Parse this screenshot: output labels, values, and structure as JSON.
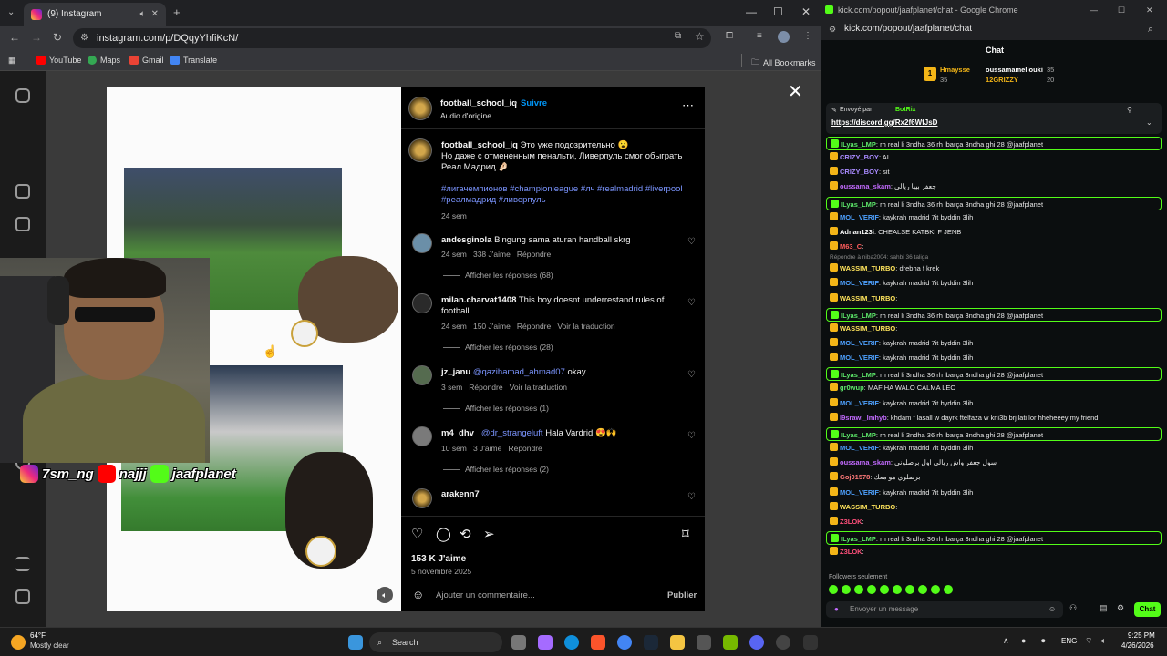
{
  "left_browser": {
    "tab_title": "(9) Instagram",
    "url": "instagram.com/p/DQqyYhfiKcN/",
    "bookmarks": [
      "YouTube",
      "Maps",
      "Gmail",
      "Translate"
    ],
    "all_bookmarks": "All Bookmarks"
  },
  "post": {
    "author": "football_school_iq",
    "follow": "Suivre",
    "audio": "Audio d'origine",
    "caption_user": "football_school_iq",
    "caption_line1": "Это уже подозрительно 😮",
    "caption_line2": "Но даже с отмененным пенальти, Ливерпуль смог обыграть",
    "caption_line3": "Реал Мадрид 🤌🏻",
    "hashtags1": "#лигачемпионов #championleague #лч #realmadrid #liverpool",
    "hashtags2": "#реалмадрид #ливерпуль",
    "caption_age": "24 sem",
    "likes": "153 K J'aime",
    "date": "5 novembre 2025",
    "comment_placeholder": "Ajouter un commentaire...",
    "publish": "Publier",
    "comments": [
      {
        "user": "andesginola",
        "text": "Bingung sama aturan handball skrg",
        "age": "24 sem",
        "likes": "338 J'aime",
        "reply": "Répondre",
        "translate": "",
        "replies": "Afficher les réponses (68)"
      },
      {
        "user": "milan.charvat1408",
        "text": "This boy doesnt underrestand rules of",
        "text2": "football",
        "age": "24 sem",
        "likes": "150 J'aime",
        "reply": "Répondre",
        "translate": "Voir la traduction",
        "replies": "Afficher les réponses (28)"
      },
      {
        "user": "jz_janu",
        "mention": "@qazihamad_ahmad07",
        "text": "okay",
        "age": "3 sem",
        "likes": "",
        "reply": "Répondre",
        "translate": "Voir la traduction",
        "replies": "Afficher les réponses (1)"
      },
      {
        "user": "m4_dhv_",
        "mention": "@dr_strangeluft",
        "text": "Hala Vardrid 😍🙌",
        "age": "10 sem",
        "likes": "3 J'aime",
        "reply": "Répondre",
        "translate": "",
        "replies": "Afficher les réponses (2)"
      },
      {
        "user": "arakenn7",
        "text": "",
        "age": "",
        "likes": "",
        "reply": "",
        "translate": "",
        "replies": ""
      }
    ]
  },
  "overlay": {
    "instagram": "7sm_ng",
    "youtube": "najjj",
    "kick": "jaafplanet"
  },
  "right_browser": {
    "title": "kick.com/popout/jaafplanet/chat - Google Chrome",
    "url": "kick.com/popout/jaafplanet/chat",
    "chat_header": "Chat",
    "gifters": [
      {
        "name": "Hmaysse",
        "count": "35"
      },
      {
        "name": "oussamamellouki",
        "count": "35"
      },
      {
        "name": "12GRIZZY",
        "count": "20"
      }
    ],
    "pinned_by": "Envoyé par",
    "pinned_user": "BotRix",
    "pinned_link": "https://discord.gg/Rx2f6WfJsD",
    "reply_context": "Répondre à niba2004: sahbi 36 taliga",
    "followers_only": "Followers seulement",
    "input_placeholder": "Envoyer un message",
    "send": "Chat",
    "messages": [
      {
        "user": "ILyas_LMP",
        "text": "rh real li 3ndha 36 rh lbarça 3ndha ghi 28 @jaafplanet",
        "color": "#5de86a",
        "hl": true
      },
      {
        "user": "CRIZY_BOY",
        "text": "AI",
        "color": "#a98bff",
        "hl": false
      },
      {
        "user": "CRIZY_BOY",
        "text": "sit",
        "color": "#a98bff",
        "hl": false
      },
      {
        "user": "oussama_skam",
        "text": "جعفر بيبا ريالي",
        "color": "#c36bff",
        "hl": false
      },
      {
        "user": "ILyas_LMP",
        "text": "rh real li 3ndha 36 rh lbarça 3ndha ghi 28 @jaafplanet",
        "color": "#5de86a",
        "hl": true
      },
      {
        "user": "MOL_VERIF",
        "text": "kaykrah madrid 7it byddin 3lih",
        "color": "#4ea1ff",
        "hl": false
      },
      {
        "user": "Adnan123i",
        "text": "CHEALSE KATBKI F JENB",
        "color": "#ffffff",
        "hl": false
      },
      {
        "user": "M63_C",
        "text": "",
        "color": "#ff5c5c",
        "hl": false
      },
      {
        "user": "WASSIM_TURBO",
        "text": "drebha f krek",
        "color": "#ffe45c",
        "hl": false
      },
      {
        "user": "MOL_VERIF",
        "text": "kaykrah madrid 7it byddin 3lih",
        "color": "#4ea1ff",
        "hl": false
      },
      {
        "user": "WASSIM_TURBO",
        "text": "",
        "color": "#ffe45c",
        "hl": false
      },
      {
        "user": "ILyas_LMP",
        "text": "rh real li 3ndha 36 rh lbarça 3ndha ghi 28 @jaafplanet",
        "color": "#5de86a",
        "hl": true
      },
      {
        "user": "WASSIM_TURBO",
        "text": "",
        "color": "#ffe45c",
        "hl": false
      },
      {
        "user": "MOL_VERIF",
        "text": "kaykrah madrid 7it byddin 3lih",
        "color": "#4ea1ff",
        "hl": false
      },
      {
        "user": "MOL_VERIF",
        "text": "kaykrah madrid 7it byddin 3lih",
        "color": "#4ea1ff",
        "hl": false
      },
      {
        "user": "ILyas_LMP",
        "text": "rh real li 3ndha 36 rh lbarça 3ndha ghi 28 @jaafplanet",
        "color": "#5de86a",
        "hl": true
      },
      {
        "user": "gr0wup",
        "text": "MAFIHA WALO CALMA LEO",
        "color": "#5de86a",
        "hl": false
      },
      {
        "user": "MOL_VERIF",
        "text": "kaykrah madrid 7it byddin 3lih",
        "color": "#4ea1ff",
        "hl": false
      },
      {
        "user": "l9srawi_lmhyb",
        "text": "khdam f lasall w dayrk ftelfaza w kni3b brjilati lor hheheeey my friend",
        "color": "#c36bff",
        "hl": false
      },
      {
        "user": "ILyas_LMP",
        "text": "rh real li 3ndha 36 rh lbarça 3ndha ghi 28 @jaafplanet",
        "color": "#5de86a",
        "hl": true
      },
      {
        "user": "MOL_VERIF",
        "text": "kaykrah madrid 7it byddin 3lih",
        "color": "#4ea1ff",
        "hl": false
      },
      {
        "user": "oussama_skam",
        "text": "سول جعفر واش ريالي اول برصلوني",
        "color": "#c36bff",
        "hl": false
      },
      {
        "user": "Goj01578",
        "text": "برصلوي هو معك",
        "color": "#ff7a7a",
        "hl": false
      },
      {
        "user": "MOL_VERIF",
        "text": "kaykrah madrid 7it byddin 3lih",
        "color": "#4ea1ff",
        "hl": false
      },
      {
        "user": "WASSIM_TURBO",
        "text": "",
        "color": "#ffe45c",
        "hl": false
      },
      {
        "user": "Z3LOK",
        "text": "",
        "color": "#ff4f7a",
        "hl": false
      },
      {
        "user": "ILyas_LMP",
        "text": "rh real li 3ndha 36 rh lbarça 3ndha ghi 28 @jaafplanet",
        "color": "#5de86a",
        "hl": true
      },
      {
        "user": "Z3LOK",
        "text": "",
        "color": "#ff4f7a",
        "hl": false
      }
    ]
  },
  "taskbar": {
    "temp": "64°F",
    "weather": "Mostly clear",
    "search": "Search",
    "lang": "ENG",
    "time": "9:25 PM",
    "date": "4/26/2026"
  },
  "colors": {
    "kick_green": "#53fc18",
    "ig_blue": "#0095f6",
    "link": "#7b95ff"
  }
}
